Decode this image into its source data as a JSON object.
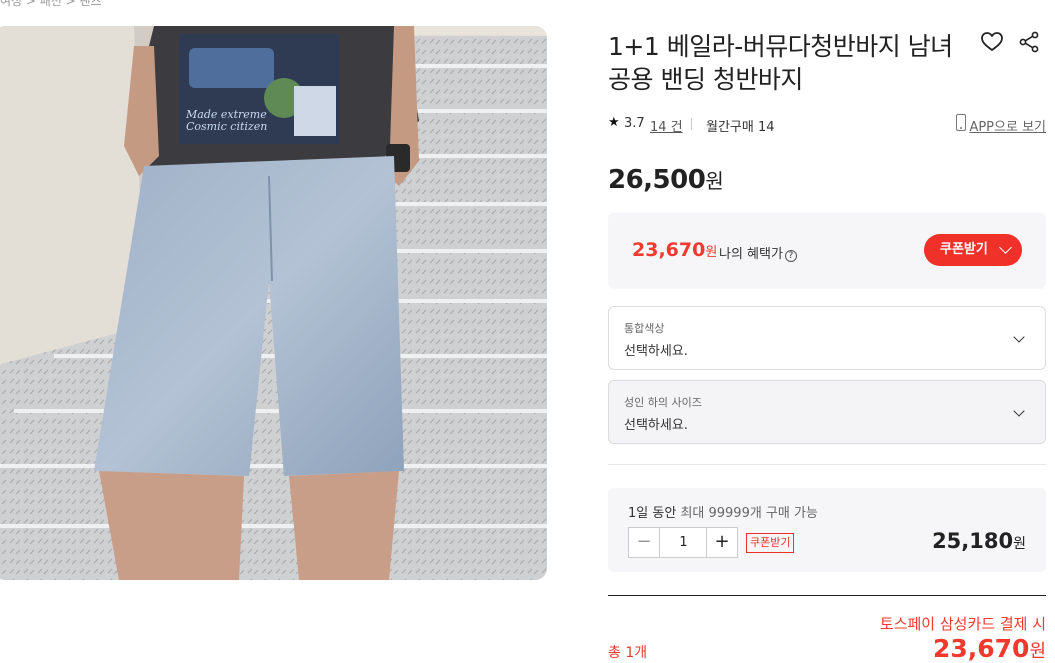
{
  "breadcrumb": "여성 > 패션 > 팬츠",
  "product": {
    "title": "1+1 베일라-버뮤다청반바지 남녀공용 밴딩 청반바지",
    "rating": "3.7",
    "reviews": "14 건",
    "monthly_sales": "월간구매 14",
    "app_link": "APP으로 보기",
    "price": "26,500",
    "currency": "원",
    "shirt_print": [
      "Made extreme",
      "Cosmic citizen"
    ]
  },
  "benefit": {
    "price": "23,670",
    "currency": "원",
    "label": "나의 혜택가",
    "info_icon": "?",
    "coupon_button": "쿠폰받기"
  },
  "options": [
    {
      "label": "통합색상",
      "placeholder": "선택하세요."
    },
    {
      "label": "성인 하의 사이즈",
      "placeholder": "선택하세요."
    }
  ],
  "order": {
    "limit_prefix": "1일 동안",
    "limit_suffix": "최대 99999개 구매 가능",
    "minus": "−",
    "quantity": "1",
    "plus": "+",
    "coupon_tag": "쿠폰받기",
    "price": "25,180",
    "currency": "원"
  },
  "summary": {
    "toss_promo": "토스페이 삼성카드 결제 시",
    "total_label": "총 1개",
    "total_price": "23,670",
    "currency": "원"
  },
  "icons": {
    "heart": "heart-icon",
    "share": "share-icon",
    "star": "star-icon",
    "phone": "phone-icon",
    "chevron": "chevron-down-icon"
  },
  "colors": {
    "accent": "#f03a2e",
    "panel": "#f6f6f8"
  }
}
